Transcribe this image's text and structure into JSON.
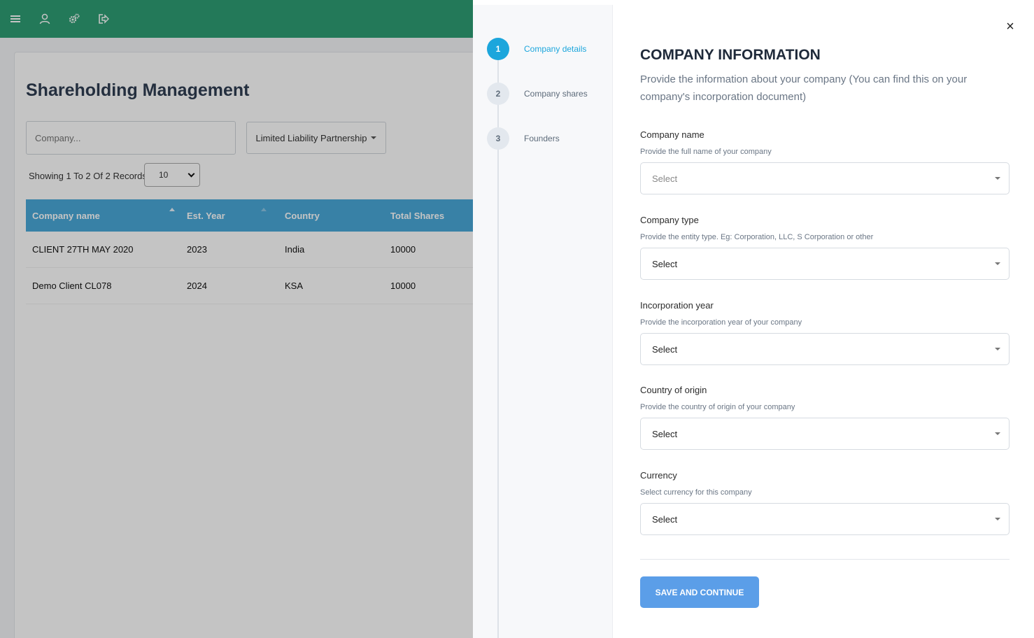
{
  "topbar": {
    "icons": [
      "menu-icon",
      "user-icon",
      "settings-icon",
      "logout-icon"
    ]
  },
  "main": {
    "title": "Shareholding Management",
    "company_placeholder": "Company...",
    "type_filter": "Limited Liability Partnership",
    "showing": "Showing 1 To 2 Of 2 Records",
    "per_page": "10",
    "columns": [
      "Company name",
      "Est. Year",
      "Country",
      "Total Shares"
    ],
    "rows": [
      {
        "name": "CLIENT 27TH MAY 2020",
        "year": "2023",
        "country": "India",
        "shares": "10000"
      },
      {
        "name": "Demo Client CL078",
        "year": "2024",
        "country": "KSA",
        "shares": "10000"
      }
    ]
  },
  "drawer": {
    "steps": [
      {
        "num": "1",
        "label": "Company details"
      },
      {
        "num": "2",
        "label": "Company shares"
      },
      {
        "num": "3",
        "label": "Founders"
      }
    ],
    "close": "×",
    "title": "COMPANY INFORMATION",
    "description": "Provide the information about your company (You can find this on your company's incorporation document)",
    "fields": [
      {
        "label": "Company name",
        "help": "Provide the full name of your company",
        "value": "Select"
      },
      {
        "label": "Company type",
        "help": "Provide the entity type. Eg: Corporation, LLC, S Corporation or other",
        "value": "Select"
      },
      {
        "label": "Incorporation year",
        "help": "Provide the incorporation year of your company",
        "value": "Select"
      },
      {
        "label": "Country of origin",
        "help": "Provide the country of origin of your company",
        "value": "Select"
      },
      {
        "label": "Currency",
        "help": "Select currency for this company",
        "value": "Select"
      }
    ],
    "save_label": "SAVE AND CONTINUE"
  },
  "colors": {
    "topbar": "#2e9e74",
    "table_header": "#4aa8d8",
    "accent": "#1ca6dc",
    "save_button": "#5b9ee8"
  }
}
